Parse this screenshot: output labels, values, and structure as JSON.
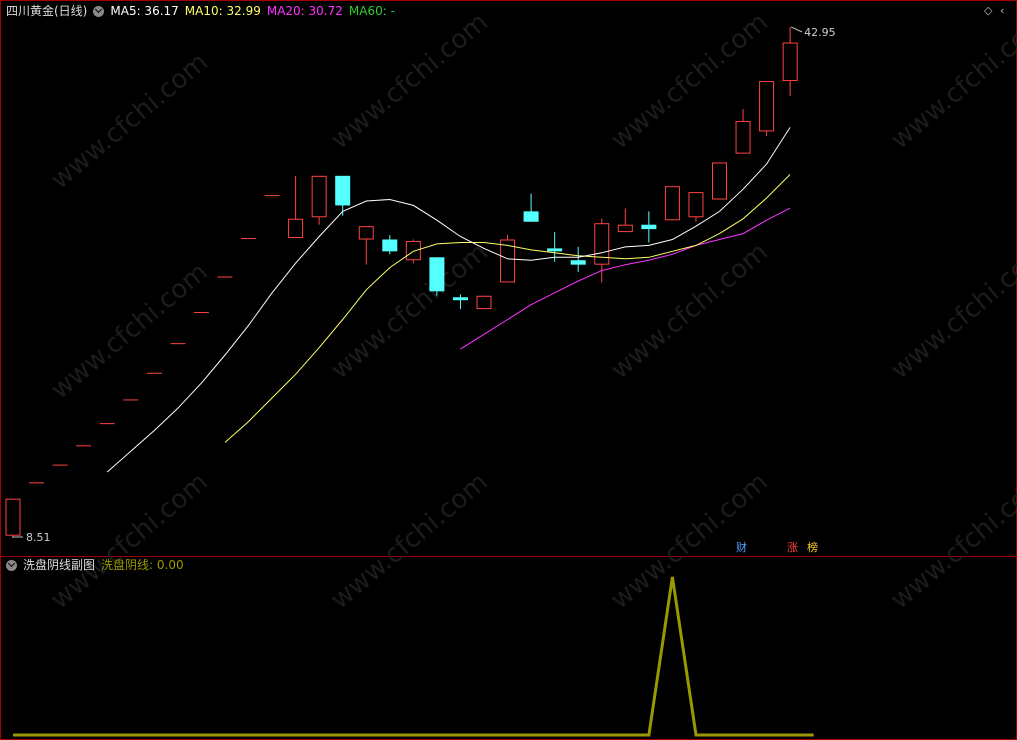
{
  "main_legend": {
    "title": "四川黄金(日线)",
    "ma5_label": "MA5: 36.17",
    "ma10_label": "MA10: 32.99",
    "ma20_label": "MA20: 30.72",
    "ma60_label": "MA60: -"
  },
  "sub_legend": {
    "title": "洗盘阴线副图",
    "series_label": "洗盘阴线: 0.00"
  },
  "badges": {
    "cai": "财",
    "zhang": "涨",
    "bang": "榜"
  },
  "annotations": {
    "high": "42.95",
    "low": "8.51"
  },
  "watermark": "www.cfchi.com",
  "colors": {
    "up": "#ff4444",
    "down": "#54ffff",
    "ma5": "#ffffff",
    "ma10": "#ffff66",
    "ma20": "#ff33ff",
    "ma60": "#33cc33",
    "sub_line": "#999900",
    "frame": "#a00000"
  },
  "chart_data": [
    {
      "type": "candlestick",
      "title": "四川黄金(日线)",
      "price_range": [
        8.51,
        42.95
      ],
      "candles": [
        {
          "o": 8.6,
          "c": 11.1,
          "h": 11.1,
          "l": 8.51
        },
        {
          "o": 12.2,
          "c": 12.2,
          "h": 12.2,
          "l": 12.2
        },
        {
          "o": 13.4,
          "c": 13.4,
          "h": 13.4,
          "l": 13.4
        },
        {
          "o": 14.7,
          "c": 14.7,
          "h": 14.7,
          "l": 14.7
        },
        {
          "o": 16.2,
          "c": 16.2,
          "h": 16.2,
          "l": 16.2
        },
        {
          "o": 17.8,
          "c": 17.8,
          "h": 17.8,
          "l": 17.8
        },
        {
          "o": 19.6,
          "c": 19.6,
          "h": 19.6,
          "l": 19.6
        },
        {
          "o": 21.6,
          "c": 21.6,
          "h": 21.6,
          "l": 21.6
        },
        {
          "o": 23.7,
          "c": 23.7,
          "h": 23.7,
          "l": 23.7
        },
        {
          "o": 26.1,
          "c": 26.1,
          "h": 26.1,
          "l": 26.1
        },
        {
          "o": 28.7,
          "c": 28.7,
          "h": 28.7,
          "l": 28.7
        },
        {
          "o": 31.6,
          "c": 31.6,
          "h": 31.6,
          "l": 31.6
        },
        {
          "o": 28.7,
          "c": 30.0,
          "h": 32.9,
          "l": 28.7
        },
        {
          "o": 30.1,
          "c": 32.9,
          "h": 32.9,
          "l": 29.6
        },
        {
          "o": 32.9,
          "c": 30.9,
          "h": 32.9,
          "l": 30.2
        },
        {
          "o": 28.6,
          "c": 29.5,
          "h": 29.5,
          "l": 26.9
        },
        {
          "o": 28.6,
          "c": 27.8,
          "h": 28.9,
          "l": 27.6
        },
        {
          "o": 27.2,
          "c": 28.5,
          "h": 28.6,
          "l": 27.0
        },
        {
          "o": 27.4,
          "c": 25.1,
          "h": 27.4,
          "l": 24.8
        },
        {
          "o": 24.7,
          "c": 24.5,
          "h": 24.9,
          "l": 23.9
        },
        {
          "o": 23.9,
          "c": 24.8,
          "h": 24.8,
          "l": 23.9
        },
        {
          "o": 25.7,
          "c": 28.6,
          "h": 28.9,
          "l": 25.7
        },
        {
          "o": 30.5,
          "c": 29.8,
          "h": 31.7,
          "l": 29.8
        },
        {
          "o": 28.0,
          "c": 27.8,
          "h": 29.1,
          "l": 27.1
        },
        {
          "o": 27.2,
          "c": 26.9,
          "h": 28.1,
          "l": 26.4
        },
        {
          "o": 26.9,
          "c": 29.7,
          "h": 30.0,
          "l": 25.7
        },
        {
          "o": 29.1,
          "c": 29.6,
          "h": 30.7,
          "l": 29.1
        },
        {
          "o": 29.6,
          "c": 29.3,
          "h": 30.5,
          "l": 28.4
        },
        {
          "o": 29.9,
          "c": 32.2,
          "h": 32.2,
          "l": 29.9
        },
        {
          "o": 30.1,
          "c": 31.8,
          "h": 31.8,
          "l": 29.8
        },
        {
          "o": 31.3,
          "c": 33.8,
          "h": 33.8,
          "l": 31.3
        },
        {
          "o": 34.4,
          "c": 36.6,
          "h": 37.4,
          "l": 34.4
        },
        {
          "o": 35.9,
          "c": 39.3,
          "h": 39.3,
          "l": 35.6
        },
        {
          "o": 39.3,
          "c": 41.9,
          "h": 42.95,
          "l": 38.3
        }
      ],
      "ma5": [
        null,
        null,
        null,
        null,
        12.9,
        14.3,
        15.7,
        17.2,
        18.9,
        20.8,
        22.8,
        25.0,
        27.0,
        28.8,
        30.5,
        31.2,
        31.3,
        30.9,
        29.9,
        28.8,
        28.0,
        27.3,
        27.2,
        27.4,
        27.4,
        27.7,
        28.1,
        28.2,
        28.6,
        29.5,
        30.5,
        32.0,
        33.7,
        36.17
      ],
      "ma10": [
        null,
        null,
        null,
        null,
        null,
        null,
        null,
        null,
        null,
        14.9,
        16.3,
        17.9,
        19.5,
        21.3,
        23.2,
        25.2,
        26.7,
        27.8,
        28.3,
        28.4,
        28.4,
        28.2,
        27.9,
        27.7,
        27.5,
        27.4,
        27.3,
        27.4,
        27.8,
        28.2,
        29.0,
        30.0,
        31.4,
        32.99
      ],
      "ma20": [
        null,
        null,
        null,
        null,
        null,
        null,
        null,
        null,
        null,
        null,
        null,
        null,
        null,
        null,
        null,
        null,
        null,
        null,
        null,
        21.2,
        22.2,
        23.2,
        24.2,
        25.0,
        25.8,
        26.5,
        26.9,
        27.2,
        27.6,
        28.2,
        28.6,
        29.0,
        29.9,
        30.72
      ],
      "ma60": []
    },
    {
      "type": "line",
      "title": "洗盘阴线副图",
      "series": [
        {
          "name": "洗盘阴线",
          "values": [
            0,
            0,
            0,
            0,
            0,
            0,
            0,
            0,
            0,
            0,
            0,
            0,
            0,
            0,
            0,
            0,
            0,
            0,
            0,
            0,
            0,
            0,
            0,
            0,
            0,
            0,
            0,
            0,
            1,
            0,
            0,
            0,
            0,
            0,
            0
          ]
        }
      ]
    }
  ]
}
